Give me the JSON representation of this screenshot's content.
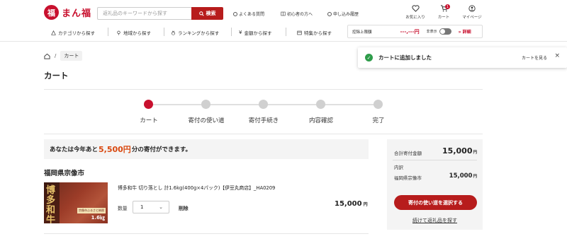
{
  "header": {
    "logo_badge": "福",
    "logo_text": "まん福",
    "search_placeholder": "返礼品のキーワードから探す",
    "search_button": "検索",
    "links": [
      "よくある質問",
      "初心者の方へ",
      "申し込み履歴"
    ],
    "icons": {
      "favorites": "お気に入り",
      "cart": "カート",
      "mypage": "マイページ",
      "cart_count": "1"
    }
  },
  "nav": {
    "items": [
      "カテゴリから探す",
      "地域から探す",
      "ランキングから探す",
      "金額から探す",
      "特集から探す"
    ],
    "limit_label": "控除上限額",
    "limit_value": "---,---円",
    "toggle_label": "非表示",
    "detail_link": "» 詳細"
  },
  "breadcrumb": {
    "current": "カート"
  },
  "page_title": "カート",
  "steps": [
    "カート",
    "寄付の使い道",
    "寄付手続き",
    "内容確認",
    "完了"
  ],
  "notice": {
    "prefix": "あなたは今年あと",
    "amount": "5,500円",
    "suffix": "分の寄付ができます。"
  },
  "item": {
    "municipality": "福岡県宗像市",
    "name": "博多和牛 切り落とし 計1.6kg(400g×4パック)【伊豆丸商店】_HA0209",
    "qty_label": "数量",
    "qty_value": "1",
    "delete": "削除",
    "price": "15,000",
    "yen": "円",
    "thumb_brand": "博多和牛",
    "thumb_weight": "1.6㎏",
    "thumb_tag": "宗像市ふるさと納税"
  },
  "summary": {
    "total_label": "合計寄付金額",
    "total_value": "15,000",
    "breakdown_label": "内訳",
    "muni_label": "福岡県宗像市",
    "muni_value": "15,000",
    "yen": "円",
    "cta": "寄付の使い道を選択する",
    "continue": "続けて返礼品を探す"
  },
  "toast": {
    "message": "カートに追加しました",
    "link": "カートを見る",
    "close": "×"
  },
  "colors": {
    "brand_red": "#c8102e",
    "button_red": "#b71c1c",
    "accent_orange": "#d9480f",
    "success_green": "#2e9c4a"
  }
}
